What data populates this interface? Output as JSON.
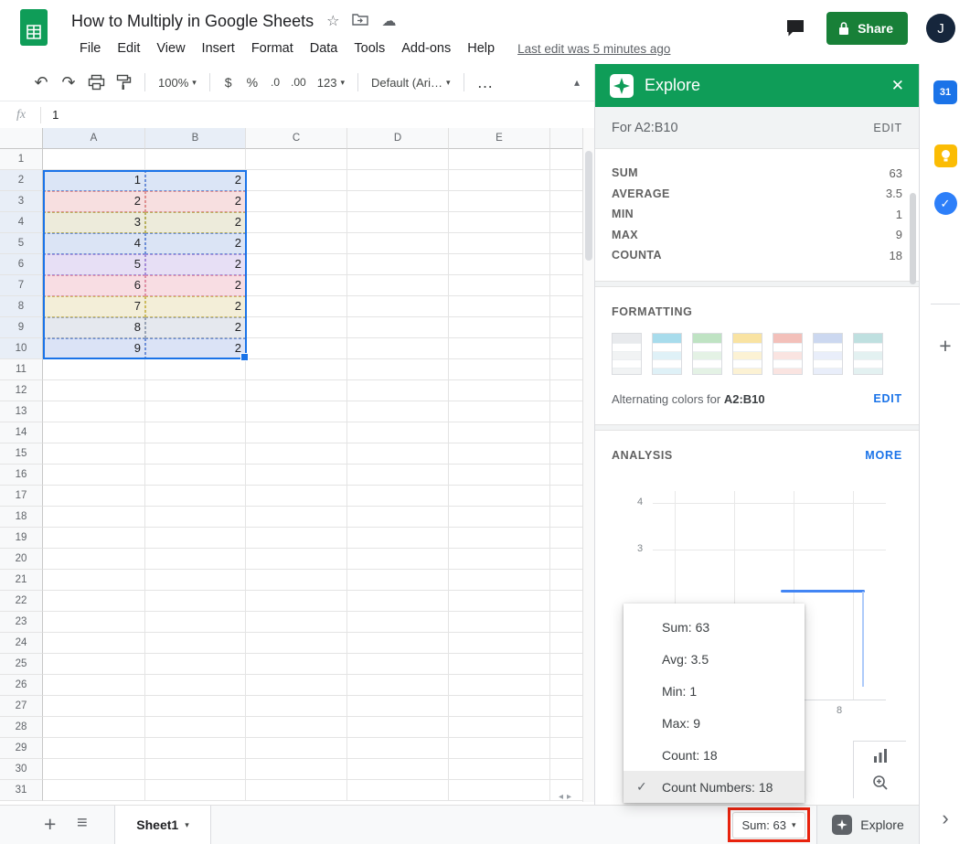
{
  "header": {
    "title": "How to Multiply in Google Sheets",
    "menu_items": [
      "File",
      "Edit",
      "View",
      "Insert",
      "Format",
      "Data",
      "Tools",
      "Add-ons",
      "Help"
    ],
    "last_edit": "Last edit was 5 minutes ago",
    "share_label": "Share",
    "avatar_initial": "J"
  },
  "toolbar": {
    "zoom_value": "100%",
    "currency": "$",
    "percent": "%",
    "dec_dec": ".0",
    "dec_inc": ".00",
    "more_formats": "123",
    "font_name": "Default (Ari…",
    "overflow": "…"
  },
  "formula_bar": {
    "fx_label": "fx",
    "value": "1"
  },
  "grid": {
    "col_headers": [
      "A",
      "B",
      "C",
      "D",
      "E",
      ""
    ],
    "row_count": 31,
    "selected_range": "A2:B10",
    "data_rows": [
      {
        "row": 2,
        "a": "1",
        "b": "2",
        "bg": "#dbe5f6",
        "dash": "#6d8fd8"
      },
      {
        "row": 3,
        "a": "2",
        "b": "2",
        "bg": "#f7dfe0",
        "dash": "#e08f8f"
      },
      {
        "row": 4,
        "a": "3",
        "b": "2",
        "bg": "#edebdb",
        "dash": "#b8b05e"
      },
      {
        "row": 5,
        "a": "4",
        "b": "2",
        "bg": "#dbe4f5",
        "dash": "#6d8fd8"
      },
      {
        "row": 6,
        "a": "5",
        "b": "2",
        "bg": "#e7dff5",
        "dash": "#a58bd8"
      },
      {
        "row": 7,
        "a": "6",
        "b": "2",
        "bg": "#f8dde3",
        "dash": "#e08fa5"
      },
      {
        "row": 8,
        "a": "7",
        "b": "2",
        "bg": "#f3eed8",
        "dash": "#cdbb5e"
      },
      {
        "row": 9,
        "a": "8",
        "b": "2",
        "bg": "#e5e8ee",
        "dash": "#97a2b5"
      },
      {
        "row": 10,
        "a": "9",
        "b": "2",
        "bg": "#dbe3f6",
        "dash": "#6d8fd8"
      }
    ]
  },
  "explore": {
    "title": "Explore",
    "range_label": "For A2:B10",
    "range_edit": "EDIT",
    "stats": [
      {
        "label": "SUM",
        "value": "63"
      },
      {
        "label": "AVERAGE",
        "value": "3.5"
      },
      {
        "label": "MIN",
        "value": "1"
      },
      {
        "label": "MAX",
        "value": "9"
      },
      {
        "label": "COUNTA",
        "value": "18"
      }
    ],
    "formatting": {
      "heading": "FORMATTING",
      "swatches": [
        {
          "name": "gray",
          "header": "#e8eaed",
          "row": "#f1f3f4"
        },
        {
          "name": "cyan",
          "header": "#a8dcec",
          "row": "#dff1f7"
        },
        {
          "name": "green",
          "header": "#bfe3c3",
          "row": "#e4f2e5"
        },
        {
          "name": "yellow",
          "header": "#f9e3a2",
          "row": "#fcf2d4"
        },
        {
          "name": "red",
          "header": "#f3c0ba",
          "row": "#fae4e1"
        },
        {
          "name": "indigo",
          "header": "#ccd8f0",
          "row": "#e9eefa"
        },
        {
          "name": "teal",
          "header": "#bfe0e0",
          "row": "#e3f1f1"
        }
      ],
      "caption_prefix": "Alternating colors for ",
      "caption_range": "A2:B10",
      "edit_label": "EDIT"
    },
    "analysis": {
      "heading": "ANALYSIS",
      "more_label": "MORE",
      "y_tick_top": "4",
      "y_tick_bottom": "3",
      "x_tick": "8"
    }
  },
  "context_menu": {
    "items": [
      {
        "label": "Sum: 63",
        "checked": false
      },
      {
        "label": "Avg: 3.5",
        "checked": false
      },
      {
        "label": "Min: 1",
        "checked": false
      },
      {
        "label": "Max: 9",
        "checked": false
      },
      {
        "label": "Count: 18",
        "checked": false
      },
      {
        "label": "Count Numbers: 18",
        "checked": true
      }
    ]
  },
  "bottom_bar": {
    "sheet_tab_label": "Sheet1",
    "sum_selector_label": "Sum: 63",
    "explore_button_label": "Explore"
  },
  "side_rail": {
    "calendar_label": "31"
  },
  "icons": {
    "undo": "↶",
    "redo": "↷",
    "star": "☆",
    "cloud": "☁",
    "caret_down": "▾",
    "collapse": "▴",
    "close": "✕",
    "plus": "+",
    "menu_list": "≡",
    "chevron_right": "›",
    "check": "✓",
    "scroll_left": "◂",
    "scroll_right": "▸"
  },
  "colors": {
    "explore_green": "#0f9d58",
    "share_green": "#188038",
    "link_blue": "#1a73e8",
    "selection_blue": "#1a73e8",
    "annotation_red": "#e8230e"
  }
}
